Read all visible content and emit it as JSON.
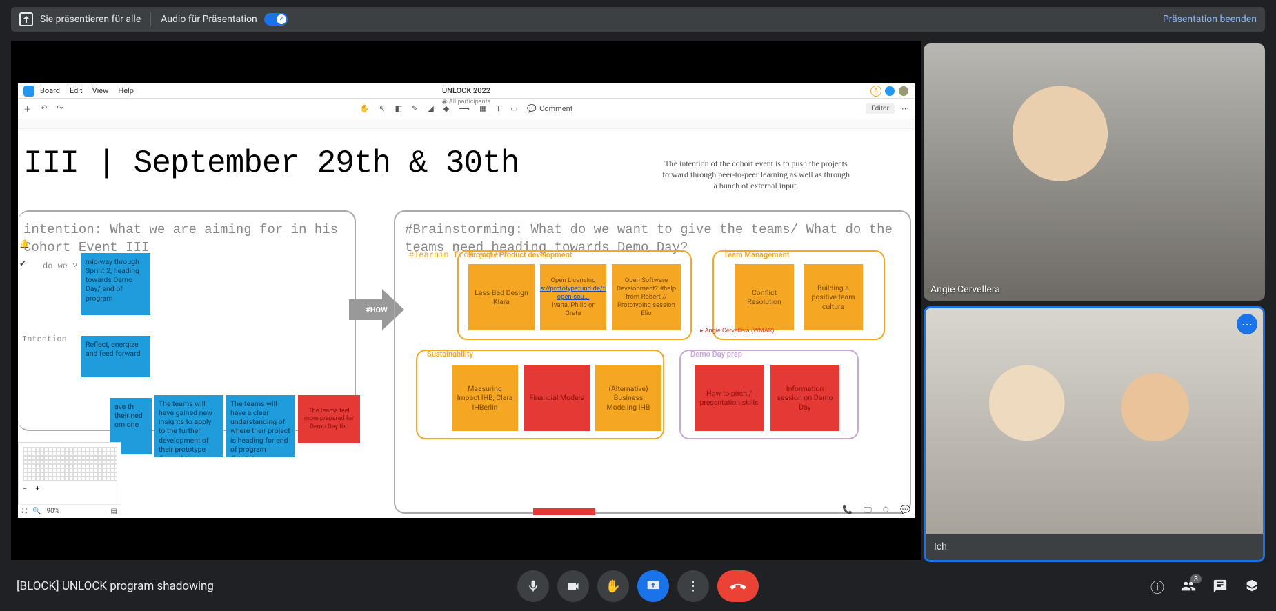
{
  "topbar": {
    "presenting": "Sie präsentieren für alle",
    "audio": "Audio für Präsentation",
    "end": "Präsentation beenden"
  },
  "slide": {
    "menu": {
      "board": "Board",
      "edit": "Edit",
      "view": "View",
      "help": "Help"
    },
    "title": "UNLOCK 2022",
    "participants": "All participants",
    "toolbar": {
      "comment": "Comment",
      "editor": "Editor"
    },
    "heading": "III  |  September 29th & 30th",
    "intention_paragraph": "The intention of the cohort event is to push the projects forward through peer-to-peer learning as well as through a bunch of external input.",
    "left_box_head": "intention: What we are aiming for in his Cohort Event III",
    "right_box_head": "#Brainstorming: What do we want to give the teams/ What do the teams need heading towards Demo Day?",
    "arrow": "#HOW",
    "learning_tag": "#learnin   from expert",
    "cursor": "Angie Cervellera (WMAR)",
    "qlabel": "do we ?",
    "intention_word": "Intention",
    "notes_blue": {
      "n1": "mid-way through Sprint 2, heading towards Demo Day/ end of program",
      "n2": "Reflect, energize and feed forward",
      "n3": "ave th their ned om one",
      "n4": "The teams will have gained new insights to apply to the further development of their prototype #crunchtime",
      "n5": "The teams will have a clear understanding of where their project is heading for end of program #prototype definition"
    },
    "notes_red_bottom": "The teams feel more prepared for Demo Day tbc",
    "groups": {
      "project": {
        "label": "Project / Product development",
        "n1": "Less Bad Design Klara",
        "n2_a": "Open Licensing",
        "n2_b": "https://prototypefund.de/freie-open-sou...",
        "n2_c": "Ivana, Philip or Greta",
        "n3": "Open Software Development? #help from Robert // Prototyping session Elio"
      },
      "team": {
        "label": "Team Management",
        "n1": "Conflict Resolution",
        "n2": "Building a positive team culture"
      },
      "sustain": {
        "label": "Sustainability",
        "n1": "Measuring Impact IHB, Clara IHBerlin",
        "n2": "Financial Models",
        "n3": "(Alternative) Business Modeling IHB"
      },
      "demo": {
        "label": "Demo Day prep",
        "n1": "How to pitch / presentation skills",
        "n2": "Information session on Demo Day"
      }
    },
    "zoom": "90%"
  },
  "videos": {
    "p1": "Angie Cervellera",
    "p2": "Ich"
  },
  "bottom": {
    "meeting": "[BLOCK] UNLOCK program shadowing",
    "count": "3"
  }
}
